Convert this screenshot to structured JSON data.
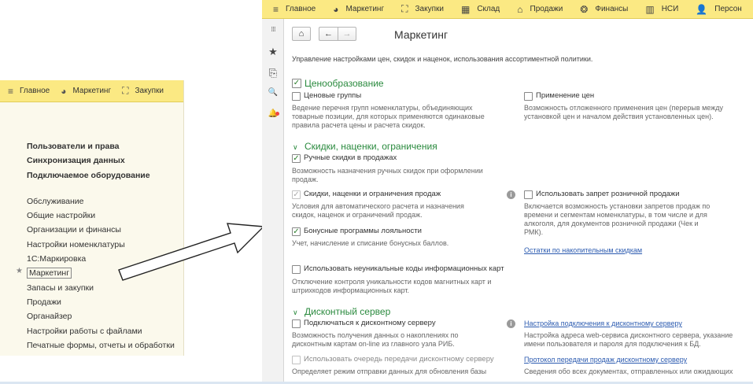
{
  "left": {
    "topbar": [
      "Главное",
      "Маркетинг",
      "Закупки"
    ],
    "menu_bold": [
      "Пользователи и права",
      "Синхронизация данных",
      "Подключаемое оборудование"
    ],
    "menu": [
      "Обслуживание",
      "Общие настройки",
      "Организации и финансы",
      "Настройки номенклатуры",
      "1С:Маркировка",
      "Маркетинг",
      "Запасы и закупки",
      "Продажи",
      "Органайзер",
      "Настройки работы с файлами",
      "Печатные формы, отчеты и обработки"
    ],
    "star": "★"
  },
  "topbar": [
    "Главное",
    "Маркетинг",
    "Закупки",
    "Склад",
    "Продажи",
    "Финансы",
    "НСИ",
    "Персон"
  ],
  "icons": {
    "menu": "≡",
    "marketing": "◕",
    "purchases": "⛶",
    "warehouse": "▦",
    "sales": "⌂",
    "finance": "❂",
    "nsi": "▥",
    "person": "👤",
    "apps": "⁝⁝⁝",
    "favorites": "★",
    "history": "⎘",
    "search": "🔍",
    "bell": "🔔",
    "home": "⌂",
    "back": "←",
    "forward": "→",
    "check": "✓",
    "chevron": "∨",
    "info": "i"
  },
  "page": {
    "title": "Маркетинг",
    "description": "Управление настройками цен, скидок и наценок, использования ассортиментной политики."
  },
  "sections": {
    "pricing": {
      "title": "Ценообразование",
      "price_groups": {
        "label": "Ценовые группы",
        "desc_1": "Ведение перечня групп номенклатуры, объединяющих",
        "desc_2": "товарные позиции, для которых применяются одинаковые",
        "desc_3": "правила расчета цены и расчета скидок."
      },
      "price_apply": {
        "label": "Применение цен",
        "desc_1": "Возможность отложенного применения цен (перерыв между",
        "desc_2": "установкой цен и началом действия установленных цен)."
      }
    },
    "discounts": {
      "title": "Скидки, наценки, ограничения",
      "manual": {
        "label": "Ручные скидки в продажах",
        "desc_1": "Возможность назначения ручных скидок при оформлении",
        "desc_2": "продаж."
      },
      "auto": {
        "label": "Скидки, наценки и ограничения продаж",
        "desc_1": "Условия для автоматического расчета и назначения",
        "desc_2": "скидок, наценок и ограничений продаж."
      },
      "retail_ban": {
        "label": "Использовать запрет розничной продажи",
        "desc_1": "Включается возможность установки запретов продаж по",
        "desc_2": "времени и сегментам номенклатуры, в том числе и для",
        "desc_3": "алкоголя, для документов розничной продажи (Чек и",
        "desc_4": "РМК)."
      },
      "bonus": {
        "label": "Бонусные программы лояльности",
        "desc": "Учет, начисление и списание бонусных баллов."
      },
      "link_balances": "Остатки по накопительным скидкам",
      "nonunique": {
        "label": "Использовать неуникальные коды информационных карт",
        "desc_1": "Отключение контроля уникальности кодов магнитных карт и",
        "desc_2": "штрихкодов информационных карт."
      }
    },
    "discount_server": {
      "title": "Дисконтный сервер",
      "connect": {
        "label": "Подключаться к дисконтному серверу",
        "desc_1": "Возможность получения данных о накоплениях по",
        "desc_2": "дисконтным картам on-line из главного узла РИБ."
      },
      "link_settings": "Настройка подключения к дисконтному серверу",
      "settings_desc_1": "Настройка адреса web-сервиса дисконтного сервера, указание",
      "settings_desc_2": "имени пользователя и пароля для подключения к БД.",
      "queue": {
        "label": "Использовать очередь передачи дисконтному серверу",
        "desc_1": "Определяет режим отправки данных для обновления базы"
      },
      "link_protocol": "Протокол передачи продаж дисконтному серверу",
      "protocol_desc_1": "Сведения обо всех документах, отправленных или ожидающих"
    }
  }
}
